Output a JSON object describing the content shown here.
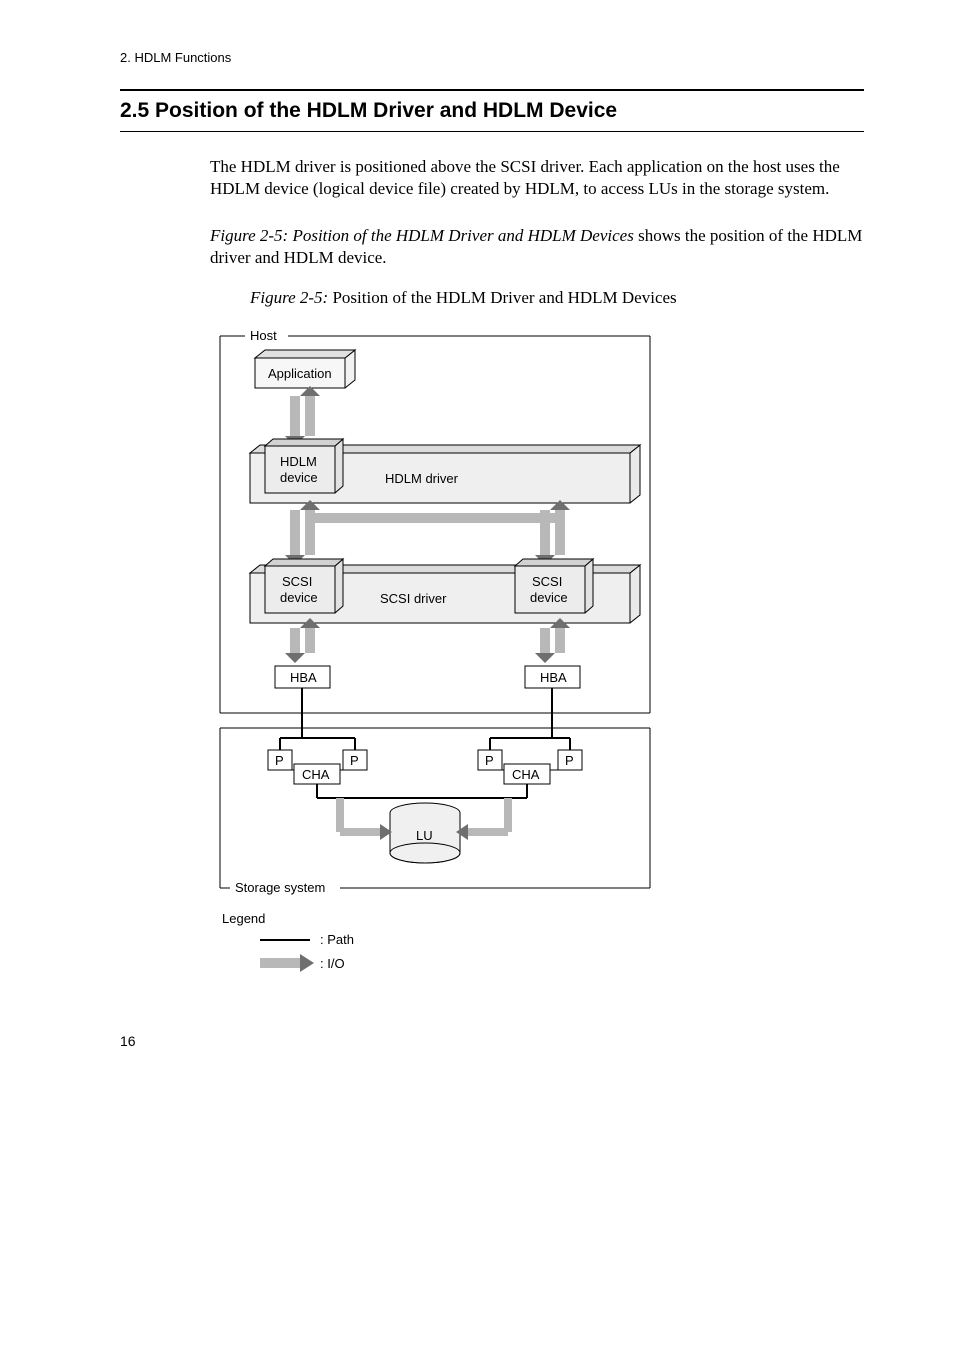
{
  "running_header": "2. HDLM Functions",
  "section_heading": "2.5  Position of the HDLM Driver and HDLM Device",
  "para1": "The HDLM driver is positioned above the SCSI driver. Each application on the host uses the HDLM device (logical device file) created by HDLM, to access LUs in the storage system.",
  "para2_prefix": "Figure  2-5:  Position of the HDLM Driver and HDLM Devices",
  "para2_suffix": " shows the position of the HDLM driver and HDLM device.",
  "figure_caption_prefix": "Figure  2-5:",
  "figure_caption_body": "  Position of the HDLM Driver and HDLM Devices",
  "fig": {
    "host": "Host",
    "application": "Application",
    "hdlm_device": "HDLM",
    "hdlm_device2": "device",
    "hdlm_driver": "HDLM driver",
    "scsi_device": "SCSI",
    "scsi_device2": "device",
    "scsi_driver": "SCSI driver",
    "hba": "HBA",
    "p": "P",
    "cha": "CHA",
    "lu": "LU",
    "storage_system": "Storage system",
    "legend": "Legend",
    "legend_path": ": Path",
    "legend_io": ": I/O"
  },
  "page_number": "16"
}
